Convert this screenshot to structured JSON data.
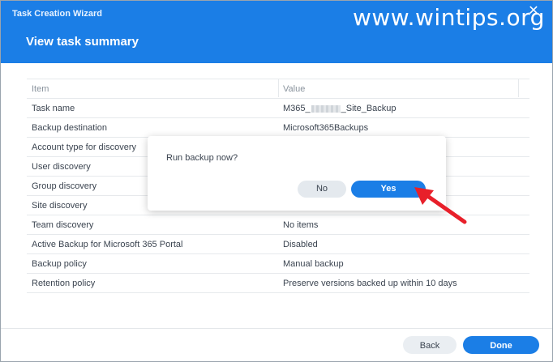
{
  "header": {
    "wizard_title": "Task Creation Wizard",
    "page_title": "View task summary",
    "watermark": "www.wintips.org",
    "colors": {
      "header_bg": "#1b7ee6",
      "primary_button": "#1b7ee6"
    }
  },
  "table": {
    "columns": [
      "Item",
      "Value"
    ],
    "rows": [
      {
        "item": "Task name",
        "value_prefix": "M365_",
        "value_suffix": "_Site_Backup"
      },
      {
        "item": "Backup destination",
        "value": "Microsoft365Backups"
      },
      {
        "item": "Account type for discovery",
        "value": ""
      },
      {
        "item": "User discovery",
        "value": ""
      },
      {
        "item": "Group discovery",
        "value": ""
      },
      {
        "item": "Site discovery",
        "value": ""
      },
      {
        "item": "Team discovery",
        "value": "No items"
      },
      {
        "item": "Active Backup for Microsoft 365 Portal",
        "value": "Disabled"
      },
      {
        "item": "Backup policy",
        "value": "Manual backup"
      },
      {
        "item": "Retention policy",
        "value": "Preserve versions backed up within 10 days"
      }
    ]
  },
  "dialog": {
    "message": "Run backup now?",
    "no_label": "No",
    "yes_label": "Yes"
  },
  "footer": {
    "back_label": "Back",
    "done_label": "Done"
  },
  "annotation": {
    "arrow_color": "#e8202a",
    "arrow_icon": "red-arrow-icon"
  }
}
